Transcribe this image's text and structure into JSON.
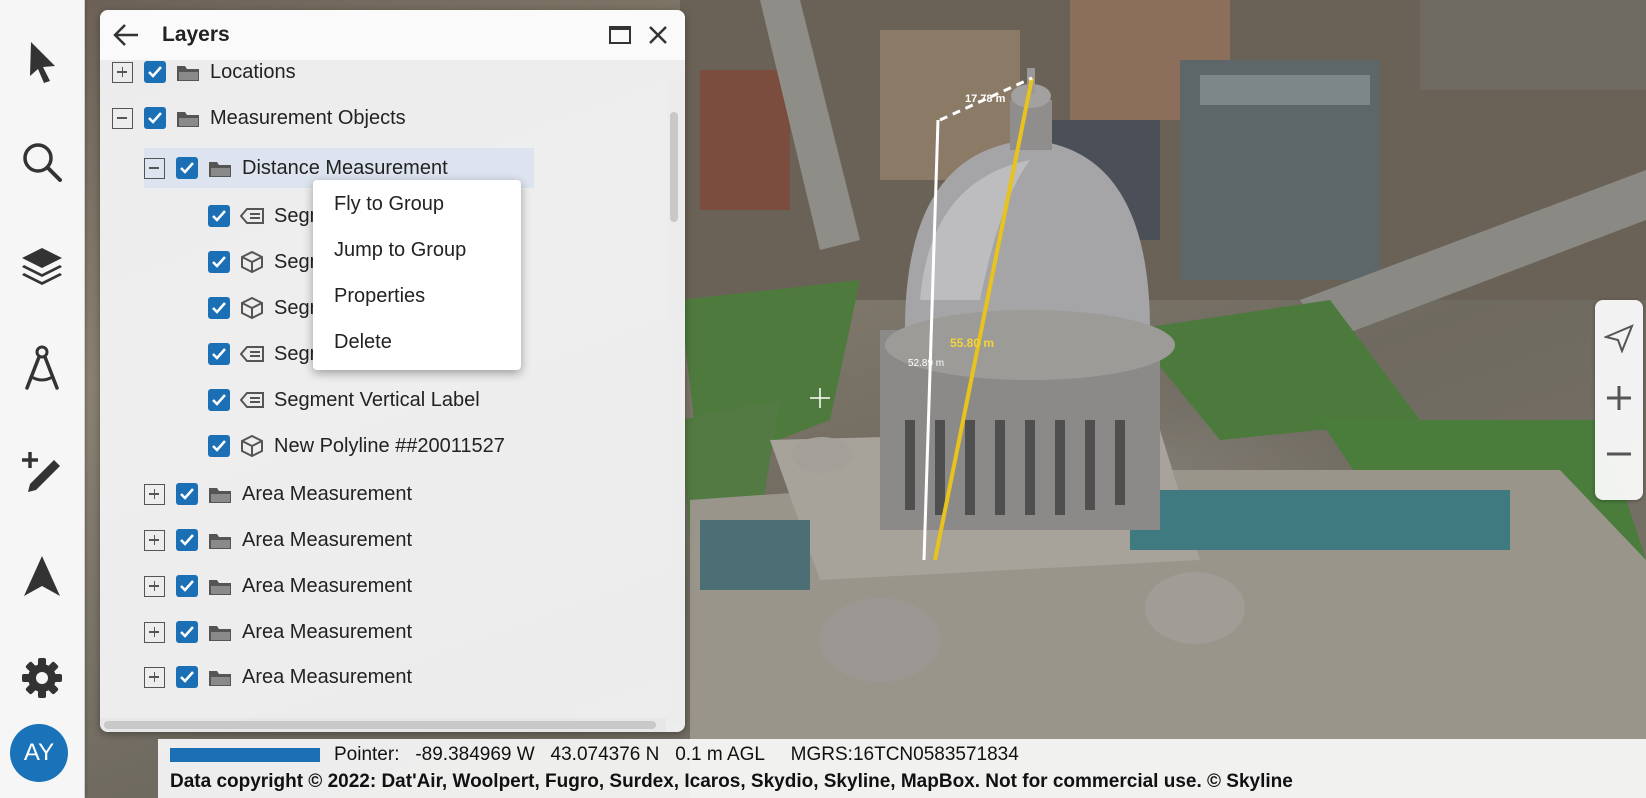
{
  "panel": {
    "title": "Layers"
  },
  "tree": [
    {
      "label": "Locations",
      "expander": "plus",
      "icon": "folder-icon"
    },
    {
      "label": "Measurement Objects",
      "expander": "minus",
      "icon": "folder-icon"
    },
    {
      "label": "Distance Measurement",
      "expander": "minus",
      "icon": "folder-icon",
      "selected": true
    },
    {
      "label": "Segment Label",
      "icon": "label-icon"
    },
    {
      "label": "Segment Line",
      "icon": "cube-icon"
    },
    {
      "label": "Segment Line",
      "icon": "cube-icon"
    },
    {
      "label": "Segment Horizontal Label",
      "icon": "label-icon"
    },
    {
      "label": "Segment Vertical Label",
      "icon": "label-icon"
    },
    {
      "label": "New Polyline ##20011527",
      "icon": "cube-icon"
    },
    {
      "label": "Area Measurement",
      "expander": "plus",
      "icon": "folder-icon"
    },
    {
      "label": "Area Measurement",
      "expander": "plus",
      "icon": "folder-icon"
    },
    {
      "label": "Area Measurement",
      "expander": "plus",
      "icon": "folder-icon"
    },
    {
      "label": "Area Measurement",
      "expander": "plus",
      "icon": "folder-icon"
    },
    {
      "label": "Area Measurement",
      "expander": "plus",
      "icon": "folder-icon"
    }
  ],
  "context_menu": {
    "items": [
      "Fly to Group",
      "Jump to Group",
      "Properties",
      "Delete"
    ]
  },
  "user": {
    "initials": "AY"
  },
  "map_labels": {
    "height_label": "17.78 m",
    "distance_label": "55.80 m",
    "horizontal_label": "52.89 m"
  },
  "status": {
    "progress": 1.0,
    "pointer_label": "Pointer:",
    "longitude": "-89.384969 W",
    "latitude": "43.074376 N",
    "altitude": "0.1 m AGL",
    "mgrs": "MGRS:16TCN0583571834",
    "copyright": "Data copyright © 2022: Dat'Air, Woolpert, Fugro, Surdex, Icaros, Skydio, Skyline, MapBox. Not for commercial use. © Skyline"
  },
  "colors": {
    "accent": "#1a6fb5",
    "avatar": "#1a73b8"
  }
}
